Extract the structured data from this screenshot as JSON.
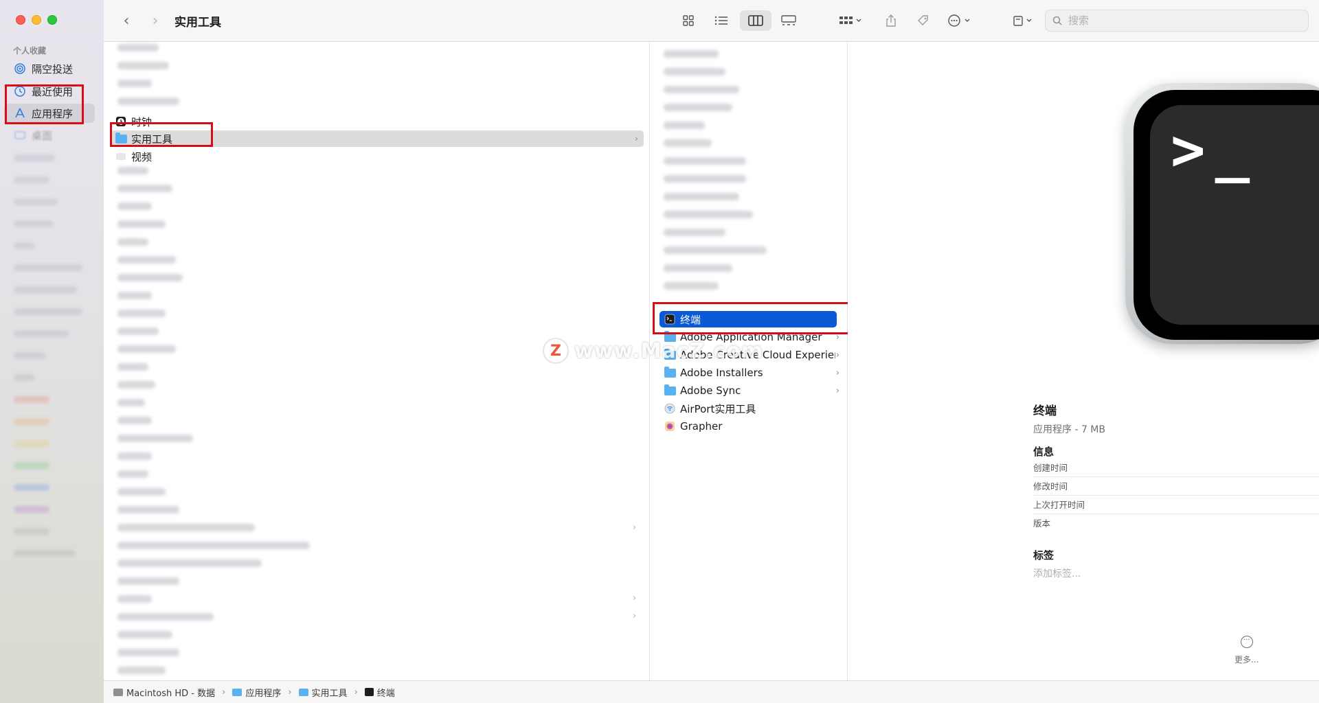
{
  "window": {
    "title": "实用工具"
  },
  "toolbar": {
    "back": "‹",
    "forward": "›",
    "search_placeholder": "搜索"
  },
  "sidebar": {
    "heading": "个人收藏",
    "items": [
      {
        "label": "隔空投送",
        "icon": "airdrop-icon"
      },
      {
        "label": "最近使用",
        "icon": "recents-clock-icon"
      },
      {
        "label": "应用程序",
        "icon": "applications-icon",
        "active": true
      },
      {
        "label": "桌面",
        "icon": "desktop-icon"
      }
    ]
  },
  "column1": {
    "rows": [
      {
        "label": "时钟",
        "icon": "clock-icon"
      },
      {
        "label": "实用工具",
        "icon": "folder-icon",
        "selected": true,
        "has_children": true
      },
      {
        "label": "视频",
        "icon": "video-icon"
      }
    ]
  },
  "column2": {
    "rows": [
      {
        "label": "终端",
        "icon": "terminal-icon",
        "selected": true
      },
      {
        "label": "Adobe Application Manager",
        "icon": "folder-icon",
        "has_children": true
      },
      {
        "label": "Adobe Creative Cloud Experience",
        "icon": "folder-icon",
        "has_children": true
      },
      {
        "label": "Adobe Installers",
        "icon": "folder-icon",
        "has_children": true
      },
      {
        "label": "Adobe Sync",
        "icon": "folder-icon",
        "has_children": true
      },
      {
        "label": "AirPort实用工具",
        "icon": "airport-icon"
      },
      {
        "label": "Grapher",
        "icon": "grapher-icon"
      }
    ]
  },
  "preview": {
    "name": "终端",
    "kind": "应用程序 - 7 MB",
    "info_heading": "信息",
    "fields": [
      "创建时间",
      "修改时间",
      "上次打开时间",
      "版本"
    ],
    "tags_heading": "标签",
    "tags_placeholder": "添加标签...",
    "more_label": "更多..."
  },
  "pathbar": [
    "Macintosh HD - 数据",
    "应用程序",
    "实用工具",
    "终端"
  ],
  "watermark": {
    "logo": "Z",
    "text": "www.MacZ.com"
  },
  "colors": {
    "highlight": "#d40e14",
    "selection_blue": "#0a5ad8",
    "folder_blue": "#5ab1f0"
  }
}
